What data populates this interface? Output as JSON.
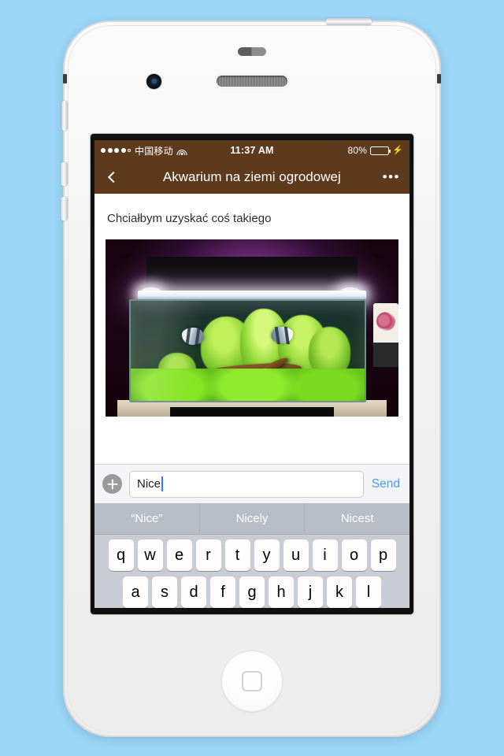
{
  "status_bar": {
    "signal_dots_filled": 4,
    "signal_dots_total": 5,
    "carrier": "中国移动",
    "wifi_icon": "wifi-icon",
    "time": "11:37 AM",
    "battery_percent": "80%",
    "battery_level": 80,
    "charging_icon": "⚡",
    "bar_color": "#5e3a1d"
  },
  "nav_bar": {
    "back_icon": "chevron-left-icon",
    "title": "Akwarium na ziemi ogrodowej",
    "more_label": "•••",
    "bar_color": "#5e3a1d"
  },
  "content": {
    "post_text": "Chciałbym uzyskać coś takiego",
    "photo_alt": "planted-aquarium-photo"
  },
  "input_bar": {
    "add_icon": "plus-circle-icon",
    "text_value": "Nice",
    "placeholder": "",
    "send_label": "Send",
    "send_color": "#4a9df0"
  },
  "keyboard": {
    "suggestions": [
      "“Nice”",
      "Nicely",
      "Nicest"
    ],
    "row1": [
      "q",
      "w",
      "e",
      "r",
      "t",
      "y",
      "u",
      "i",
      "o",
      "p"
    ],
    "row2": [
      "a",
      "s",
      "d",
      "f",
      "g",
      "h",
      "j",
      "k",
      "l"
    ]
  },
  "device": {
    "home_button": "home-button",
    "camera": "front-camera",
    "earpiece": "earpiece-speaker",
    "proximity": "proximity-sensor"
  }
}
